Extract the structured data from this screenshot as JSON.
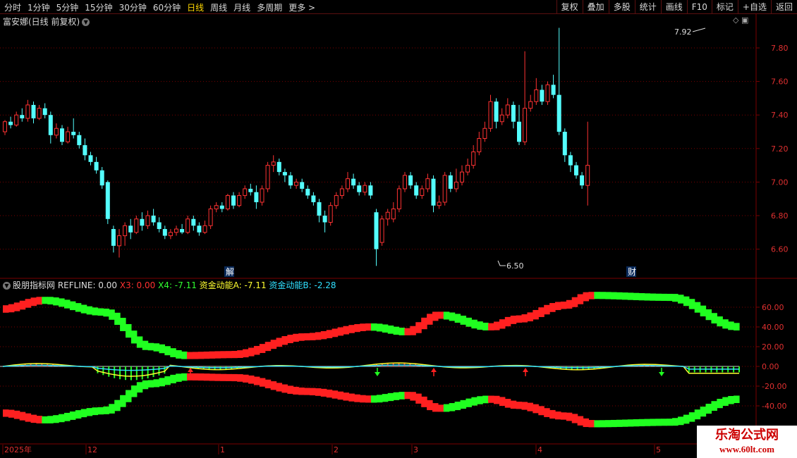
{
  "toolbar": {
    "periods": [
      "分时",
      "1分钟",
      "5分钟",
      "15分钟",
      "30分钟",
      "60分钟",
      "日线",
      "周线",
      "月线",
      "多周期",
      "更多 >"
    ],
    "active_period": "日线",
    "right_buttons": [
      "复权",
      "叠加",
      "多股",
      "统计",
      "画线",
      "F10",
      "标记",
      "+自选",
      "返回"
    ]
  },
  "main": {
    "title": "富安娜(日线 前复权)",
    "y_ticks": [
      "7.80",
      "7.60",
      "7.40",
      "7.20",
      "7.00",
      "6.80",
      "6.60"
    ],
    "high_label": "7.92",
    "low_label": "6.50",
    "event_markers": [
      "解",
      "财"
    ]
  },
  "indicator": {
    "name": "股朋指标网",
    "values": [
      {
        "text": "REFLINE: 0.00",
        "color": "#dddddd"
      },
      {
        "text": "X3: 0.00",
        "color": "#ff3030"
      },
      {
        "text": "X4: -7.11",
        "color": "#30ff30"
      },
      {
        "text": "资金动能A: -7.11",
        "color": "#ffff30"
      },
      {
        "text": "资金动能B: -2.28",
        "color": "#30e0ff"
      }
    ],
    "y_ticks": [
      "60.00",
      "40.00",
      "20.00",
      "0.00",
      "-20.00",
      "-40.00"
    ]
  },
  "dates": {
    "labels": [
      "2025年",
      "12",
      "1",
      "2",
      "3",
      "4",
      "5"
    ]
  },
  "watermark": {
    "line1": "乐淘公式网",
    "line2": "www.60lt.com"
  },
  "colors": {
    "up": "#ff3232",
    "down": "#54ffff",
    "grid": "#7a0000",
    "axis_text": "#e03030"
  },
  "chart_data": {
    "type": "candlestick",
    "price_range": [
      6.5,
      7.92
    ],
    "candles": [
      [
        7.3,
        7.36,
        7.37,
        7.28
      ],
      [
        7.36,
        7.34,
        7.39,
        7.32
      ],
      [
        7.34,
        7.4,
        7.42,
        7.33
      ],
      [
        7.4,
        7.38,
        7.44,
        7.36
      ],
      [
        7.38,
        7.46,
        7.49,
        7.36
      ],
      [
        7.46,
        7.38,
        7.48,
        7.35
      ],
      [
        7.38,
        7.44,
        7.46,
        7.37
      ],
      [
        7.44,
        7.4,
        7.47,
        7.38
      ],
      [
        7.4,
        7.28,
        7.42,
        7.23
      ],
      [
        7.28,
        7.32,
        7.35,
        7.26
      ],
      [
        7.32,
        7.24,
        7.34,
        7.22
      ],
      [
        7.24,
        7.3,
        7.33,
        7.23
      ],
      [
        7.3,
        7.28,
        7.38,
        7.26
      ],
      [
        7.28,
        7.22,
        7.3,
        7.2
      ],
      [
        7.22,
        7.16,
        7.26,
        7.13
      ],
      [
        7.16,
        7.12,
        7.18,
        7.1
      ],
      [
        7.12,
        7.07,
        7.15,
        7.05
      ],
      [
        7.07,
        6.98,
        7.09,
        6.96
      ],
      [
        7.0,
        6.78,
        7.01,
        6.75
      ],
      [
        6.72,
        6.62,
        6.74,
        6.58
      ],
      [
        6.62,
        6.68,
        6.72,
        6.55
      ],
      [
        6.68,
        6.74,
        6.76,
        6.62
      ],
      [
        6.74,
        6.7,
        6.78,
        6.66
      ],
      [
        6.7,
        6.78,
        6.8,
        6.69
      ],
      [
        6.78,
        6.74,
        6.82,
        6.71
      ],
      [
        6.74,
        6.8,
        6.83,
        6.72
      ],
      [
        6.8,
        6.76,
        6.84,
        6.74
      ],
      [
        6.76,
        6.72,
        6.79,
        6.7
      ],
      [
        6.72,
        6.68,
        6.74,
        6.66
      ],
      [
        6.68,
        6.7,
        6.72,
        6.66
      ],
      [
        6.7,
        6.72,
        6.74,
        6.68
      ],
      [
        6.72,
        6.7,
        6.75,
        6.69
      ],
      [
        6.7,
        6.78,
        6.8,
        6.69
      ],
      [
        6.78,
        6.74,
        6.8,
        6.71
      ],
      [
        6.74,
        6.7,
        6.76,
        6.68
      ],
      [
        6.7,
        6.74,
        6.77,
        6.69
      ],
      [
        6.74,
        6.84,
        6.86,
        6.72
      ],
      [
        6.84,
        6.86,
        6.88,
        6.82
      ],
      [
        6.86,
        6.84,
        6.88,
        6.82
      ],
      [
        6.84,
        6.92,
        6.93,
        6.83
      ],
      [
        6.92,
        6.86,
        6.94,
        6.84
      ],
      [
        6.86,
        6.92,
        6.94,
        6.85
      ],
      [
        6.92,
        6.96,
        6.98,
        6.9
      ],
      [
        6.96,
        6.94,
        6.99,
        6.92
      ],
      [
        6.94,
        6.88,
        6.98,
        6.84
      ],
      [
        6.88,
        6.96,
        6.98,
        6.86
      ],
      [
        6.96,
        7.1,
        7.12,
        6.94
      ],
      [
        7.1,
        7.12,
        7.16,
        7.06
      ],
      [
        7.12,
        7.06,
        7.14,
        7.04
      ],
      [
        7.06,
        7.04,
        7.08,
        7.0
      ],
      [
        7.04,
        6.98,
        7.06,
        6.96
      ],
      [
        6.98,
        7.0,
        7.02,
        6.96
      ],
      [
        7.0,
        6.96,
        7.02,
        6.94
      ],
      [
        6.96,
        6.92,
        6.98,
        6.9
      ],
      [
        6.92,
        6.88,
        6.94,
        6.86
      ],
      [
        6.88,
        6.8,
        6.9,
        6.76
      ],
      [
        6.8,
        6.76,
        6.83,
        6.7
      ],
      [
        6.76,
        6.86,
        6.88,
        6.74
      ],
      [
        6.86,
        6.92,
        6.94,
        6.84
      ],
      [
        6.92,
        6.96,
        6.98,
        6.9
      ],
      [
        6.96,
        7.02,
        7.06,
        6.94
      ],
      [
        7.02,
        6.98,
        7.05,
        6.96
      ],
      [
        6.98,
        6.94,
        7.0,
        6.92
      ],
      [
        6.94,
        6.98,
        7.0,
        6.92
      ],
      [
        6.98,
        6.92,
        7.0,
        6.9
      ],
      [
        6.82,
        6.6,
        6.84,
        6.5
      ],
      [
        6.64,
        6.78,
        6.8,
        6.62
      ],
      [
        6.78,
        6.82,
        6.84,
        6.74
      ],
      [
        6.78,
        6.84,
        6.88,
        6.76
      ],
      [
        6.84,
        6.96,
        6.98,
        6.82
      ],
      [
        6.96,
        7.04,
        7.06,
        6.94
      ],
      [
        7.04,
        6.98,
        7.06,
        6.96
      ],
      [
        6.98,
        6.92,
        7.0,
        6.9
      ],
      [
        6.92,
        6.96,
        6.98,
        6.9
      ],
      [
        6.96,
        7.02,
        7.05,
        6.94
      ],
      [
        7.02,
        6.86,
        7.04,
        6.82
      ],
      [
        6.86,
        6.88,
        6.92,
        6.84
      ],
      [
        6.88,
        7.04,
        7.06,
        6.86
      ],
      [
        7.04,
        6.96,
        7.06,
        6.94
      ],
      [
        6.96,
        7.0,
        7.08,
        6.94
      ],
      [
        7.0,
        7.06,
        7.1,
        6.98
      ],
      [
        7.06,
        7.1,
        7.14,
        7.04
      ],
      [
        7.1,
        7.18,
        7.22,
        7.08
      ],
      [
        7.18,
        7.26,
        7.3,
        7.16
      ],
      [
        7.26,
        7.32,
        7.36,
        7.24
      ],
      [
        7.32,
        7.48,
        7.52,
        7.3
      ],
      [
        7.48,
        7.36,
        7.5,
        7.32
      ],
      [
        7.36,
        7.4,
        7.44,
        7.34
      ],
      [
        7.4,
        7.46,
        7.5,
        7.38
      ],
      [
        7.46,
        7.36,
        7.48,
        7.32
      ],
      [
        7.36,
        7.24,
        7.46,
        7.22
      ],
      [
        7.24,
        7.44,
        7.78,
        7.22
      ],
      [
        7.44,
        7.48,
        7.52,
        7.42
      ],
      [
        7.48,
        7.55,
        7.62,
        7.46
      ],
      [
        7.55,
        7.48,
        7.58,
        7.46
      ],
      [
        7.48,
        7.58,
        7.6,
        7.46
      ],
      [
        7.58,
        7.52,
        7.64,
        7.5
      ],
      [
        7.52,
        7.3,
        7.92,
        7.28
      ],
      [
        7.3,
        7.16,
        7.32,
        7.12
      ],
      [
        7.16,
        7.1,
        7.18,
        7.06
      ],
      [
        7.1,
        7.04,
        7.12,
        7.02
      ],
      [
        7.04,
        6.98,
        7.06,
        6.96
      ],
      [
        6.98,
        7.1,
        7.36,
        6.86
      ]
    ],
    "indicator_range": [
      -45,
      75
    ],
    "refline": 0
  }
}
